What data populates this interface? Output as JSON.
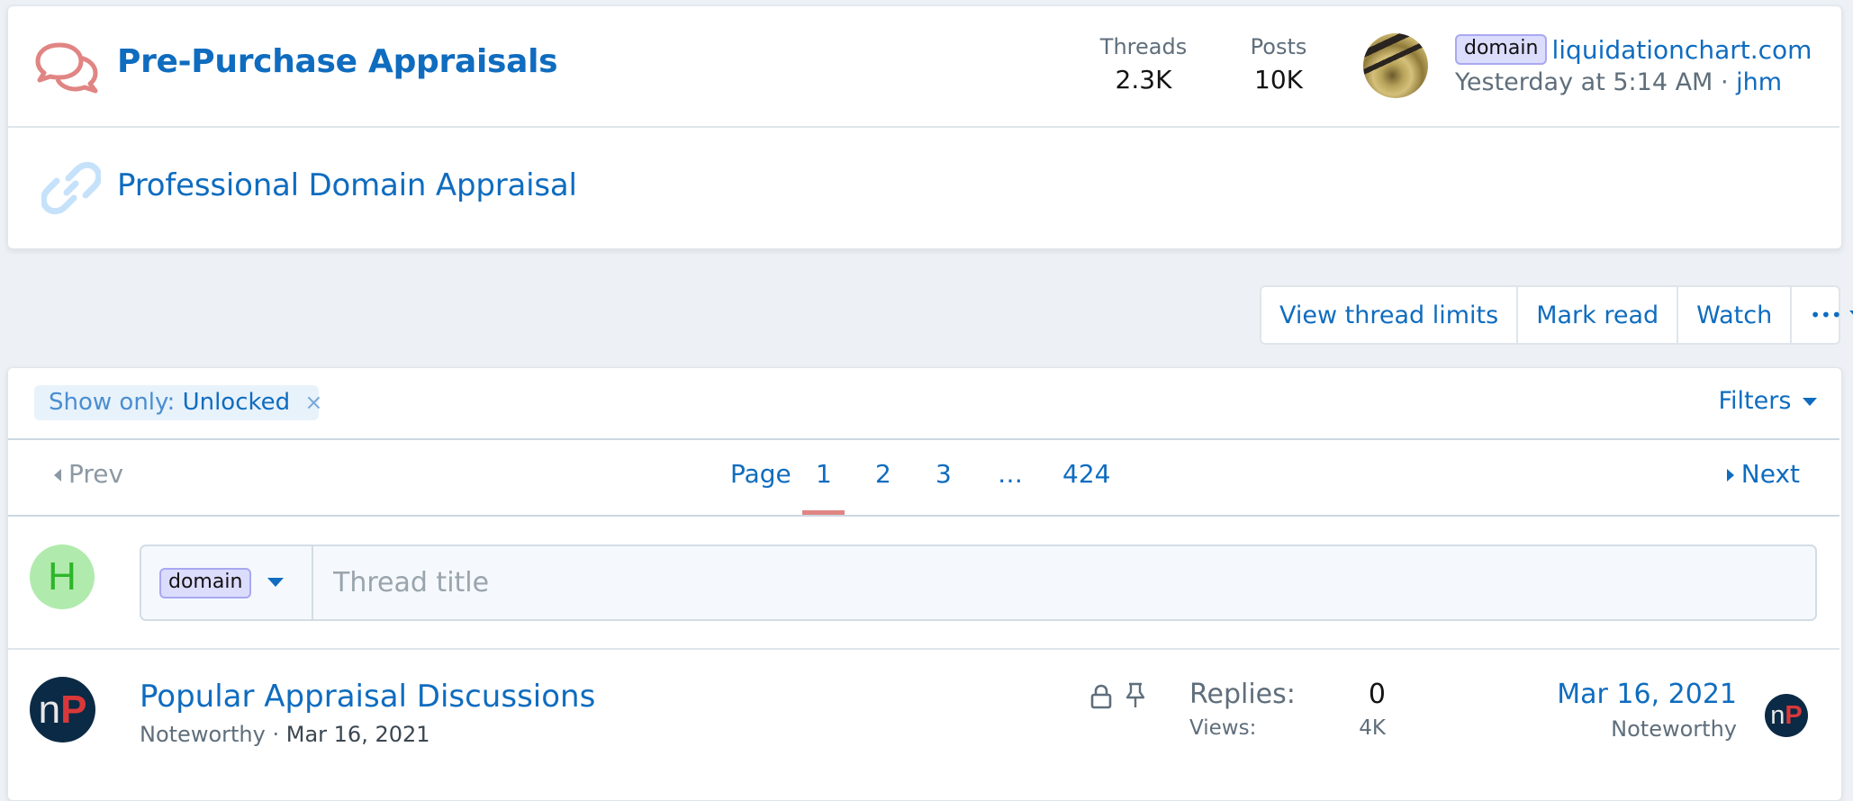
{
  "forum": {
    "title": "Pre-Purchase Appraisals",
    "icon": "comments-icon",
    "stats": {
      "threads_label": "Threads",
      "threads_value": "2.3K",
      "posts_label": "Posts",
      "posts_value": "10K"
    },
    "latest": {
      "prefix": "domain",
      "title": "liquidationchart.com",
      "time": "Yesterday at 5:14 AM",
      "separator": "·",
      "user": "jhm"
    },
    "subforum": {
      "icon": "link-icon",
      "title": "Professional Domain Appraisal"
    }
  },
  "actions": {
    "view_thread_limits": "View thread limits",
    "mark_read": "Mark read",
    "watch": "Watch",
    "more": "•••"
  },
  "filters": {
    "active_label": "Show only:",
    "active_value": "Unlocked",
    "remove": "×",
    "filters_label": "Filters"
  },
  "pagination": {
    "prev": "Prev",
    "next": "Next",
    "page_label": "Page",
    "pages": [
      "1",
      "2",
      "3",
      "…",
      "424"
    ],
    "current": "1"
  },
  "new_thread": {
    "avatar_letter": "H",
    "prefix": "domain",
    "title_placeholder": "Thread title"
  },
  "threads": [
    {
      "title": "Popular Appraisal Discussions",
      "author": "Noteworthy",
      "separator": "·",
      "start_date": "Mar 16, 2021",
      "locked": true,
      "sticky": true,
      "replies_label": "Replies:",
      "replies": "0",
      "views_label": "Views:",
      "views": "4K",
      "last_date": "Mar 16, 2021",
      "last_user": "Noteworthy",
      "avatar_text_n": "n",
      "avatar_text_p": "P"
    }
  ],
  "colors": {
    "accent": "#0f6cbf",
    "muted": "#5f6e7b",
    "comments_icon": "#e08583",
    "link_icon": "#c6e2fb",
    "current_page_marker": "#e08583",
    "badge_bg": "#dcdcfd",
    "avatar_h_bg": "#b0ebad",
    "avatar_h_fg": "#2eb52a"
  }
}
